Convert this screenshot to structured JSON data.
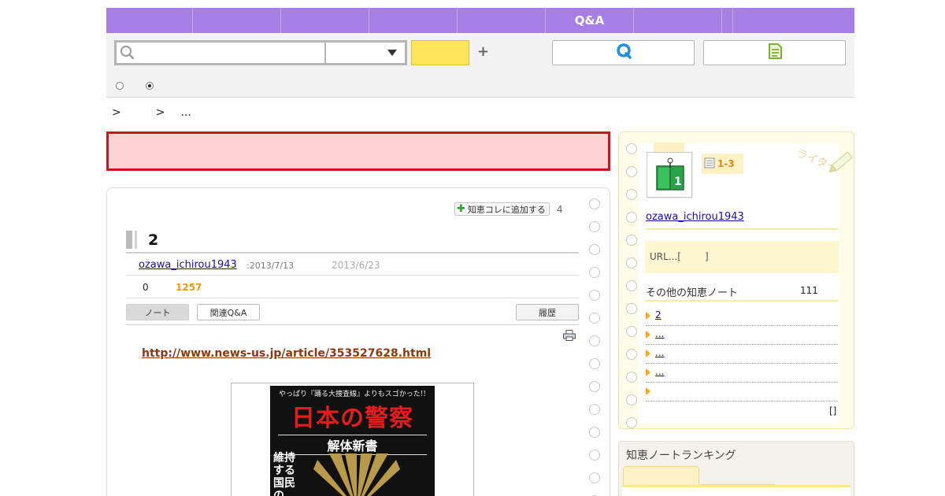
{
  "nav": {
    "items": [
      "",
      "",
      "",
      "",
      "",
      "Q&A",
      "",
      "",
      ""
    ]
  },
  "search": {
    "input_value": "",
    "category_value": "",
    "submit_label": "",
    "plus_symbol": "+"
  },
  "breadcrumb": [
    ">",
    "",
    ">",
    "..."
  ],
  "alert": {
    "link_text": ""
  },
  "note": {
    "add_chiecolle_label": "知恵コレに追加する",
    "chiecolle_count": "4",
    "title": "2",
    "author": "ozawa_ichirou1943",
    "created": ":2013/7/13",
    "updated": "2013/6/23",
    "stat_a": "0",
    "stat_b": "1257",
    "tabs": {
      "note": "ノート",
      "related_qa": "関連Q&A",
      "history": "履歴"
    },
    "external_link": "http://www.news-us.jp/article/353527628.html",
    "book": {
      "top_line": "やっぱり『踊る大捜査線』よりもスゴかった!!",
      "main_title": "日本の警察",
      "sub_title": "解体新書",
      "side_text": "維持する国民の"
    }
  },
  "sidebar": {
    "level": "1-3",
    "author": "ozawa_ichirou1943",
    "url_text": "URL...[",
    "url_close": "]",
    "other_notes_label": "その他の知恵ノート",
    "other_notes_count": "111",
    "other_notes": [
      "2",
      "...",
      "...",
      "...",
      ""
    ],
    "more_link": "[]",
    "deco_text": "ライター"
  },
  "ranking": {
    "title": "知恵ノートランキング"
  },
  "colors": {
    "nav_purple": "#a77ee6",
    "alert_red": "#c9171d",
    "alert_bg": "#ffd3d3",
    "search_yellow": "#ffe35a",
    "accent_orange": "#e89a16",
    "link_blue": "#1a0dab"
  }
}
